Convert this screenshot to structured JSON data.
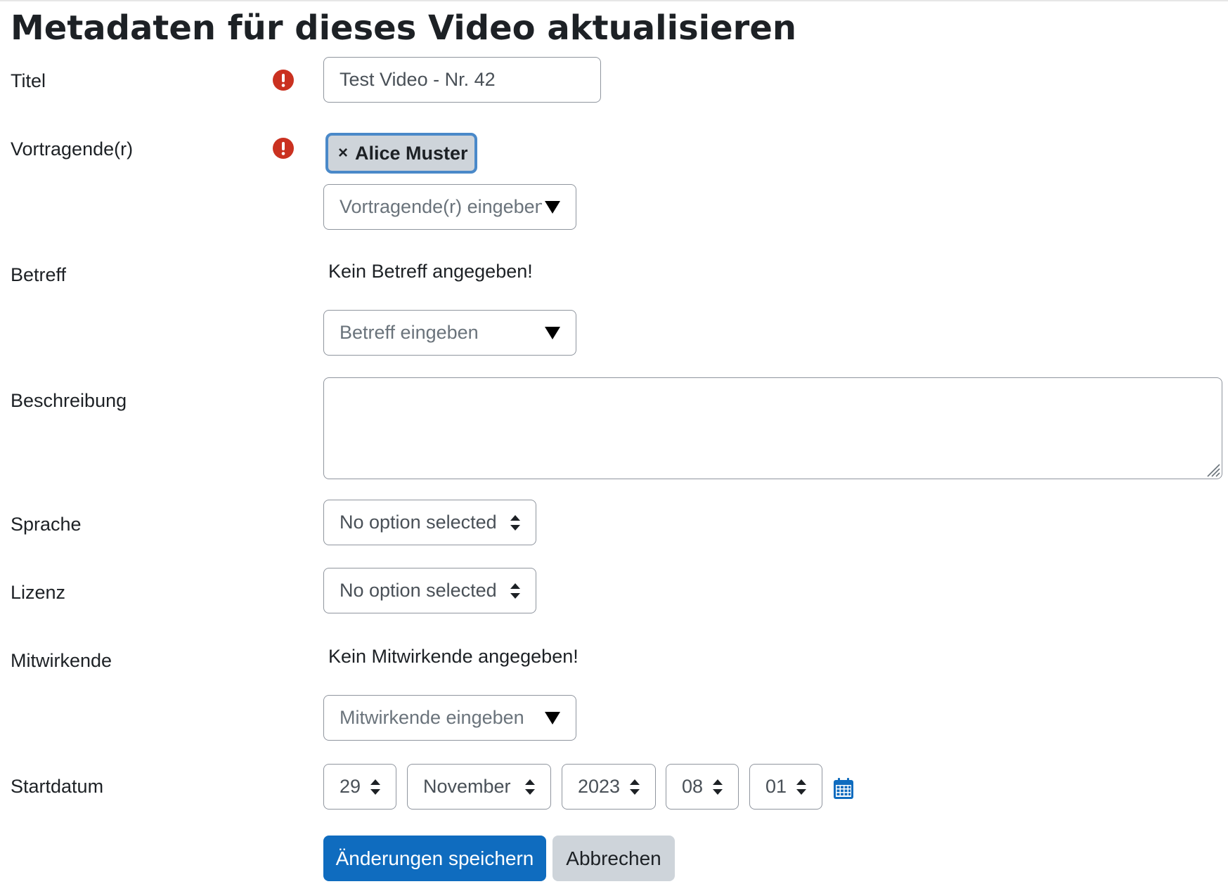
{
  "page": {
    "title": "Metadaten für dieses Video aktualisieren"
  },
  "colors": {
    "required": "#ca3120",
    "primary": "#0f6cbf",
    "secondary": "#ced4da",
    "chip_border": "#4a89c9",
    "border": "#8f959e"
  },
  "form": {
    "title": {
      "label": "Titel",
      "value": "Test Video - Nr. 42",
      "required_icon": "exclamation-circle-icon"
    },
    "presenters": {
      "label": "Vortragende(r)",
      "required_icon": "exclamation-circle-icon",
      "selected": [
        "Alice Muster"
      ],
      "remove_symbol": "×",
      "placeholder": "Vortragende(r) eingeben"
    },
    "subject": {
      "label": "Betreff",
      "empty_message": "Kein Betreff angegeben!",
      "placeholder": "Betreff eingeben"
    },
    "description": {
      "label": "Beschreibung",
      "value": ""
    },
    "language": {
      "label": "Sprache",
      "selected": "No option selected"
    },
    "license": {
      "label": "Lizenz",
      "selected": "No option selected"
    },
    "contributors": {
      "label": "Mitwirkende",
      "empty_message": "Kein Mitwirkende angegeben!",
      "placeholder": "Mitwirkende eingeben"
    },
    "start_date": {
      "label": "Startdatum",
      "day": "29",
      "month": "November",
      "year": "2023",
      "hour": "08",
      "minute": "01",
      "calendar_icon": "calendar-icon"
    }
  },
  "actions": {
    "save_label": "Änderungen speichern",
    "cancel_label": "Abbrechen"
  }
}
